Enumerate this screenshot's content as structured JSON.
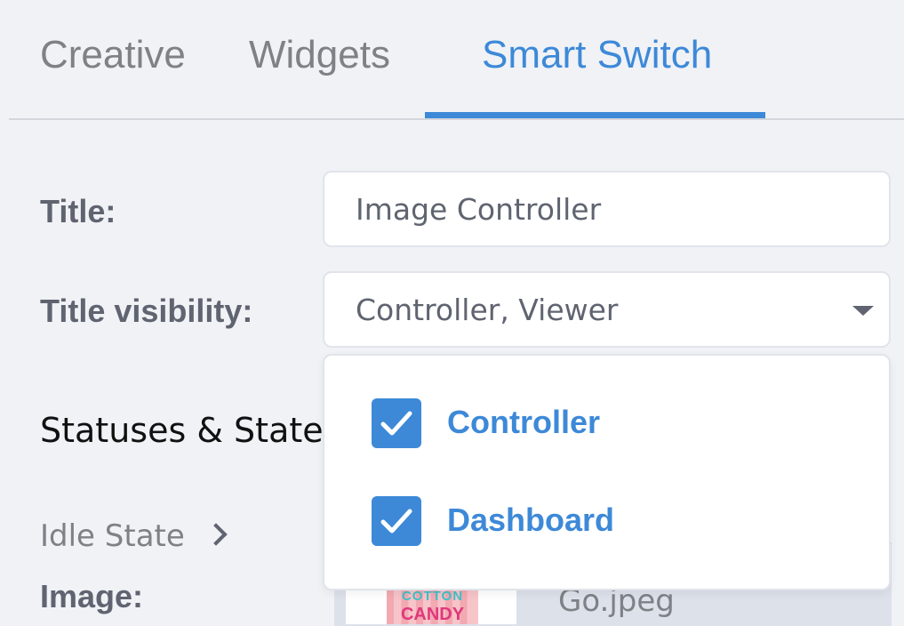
{
  "tabs": [
    {
      "label": "Creative",
      "active": false
    },
    {
      "label": "Widgets",
      "active": false
    },
    {
      "label": "Smart Switch",
      "active": true
    }
  ],
  "form": {
    "title_label": "Title:",
    "title_value": "Image Controller",
    "visibility_label": "Title visibility:",
    "visibility_value": "Controller, Viewer"
  },
  "section": {
    "heading": "Statuses & States",
    "idle_state": "Idle State",
    "image_label": "Image:",
    "file_name": "Go.jpeg",
    "thumbnail_text_1": "COTTON",
    "thumbnail_text_2": "CANDY"
  },
  "dropdown": {
    "options": [
      {
        "label": "Controller",
        "checked": true
      },
      {
        "label": "Dashboard",
        "checked": true
      }
    ]
  },
  "colors": {
    "accent": "#3d89d8",
    "background": "#f0f2f6",
    "text": "#5f6470"
  }
}
